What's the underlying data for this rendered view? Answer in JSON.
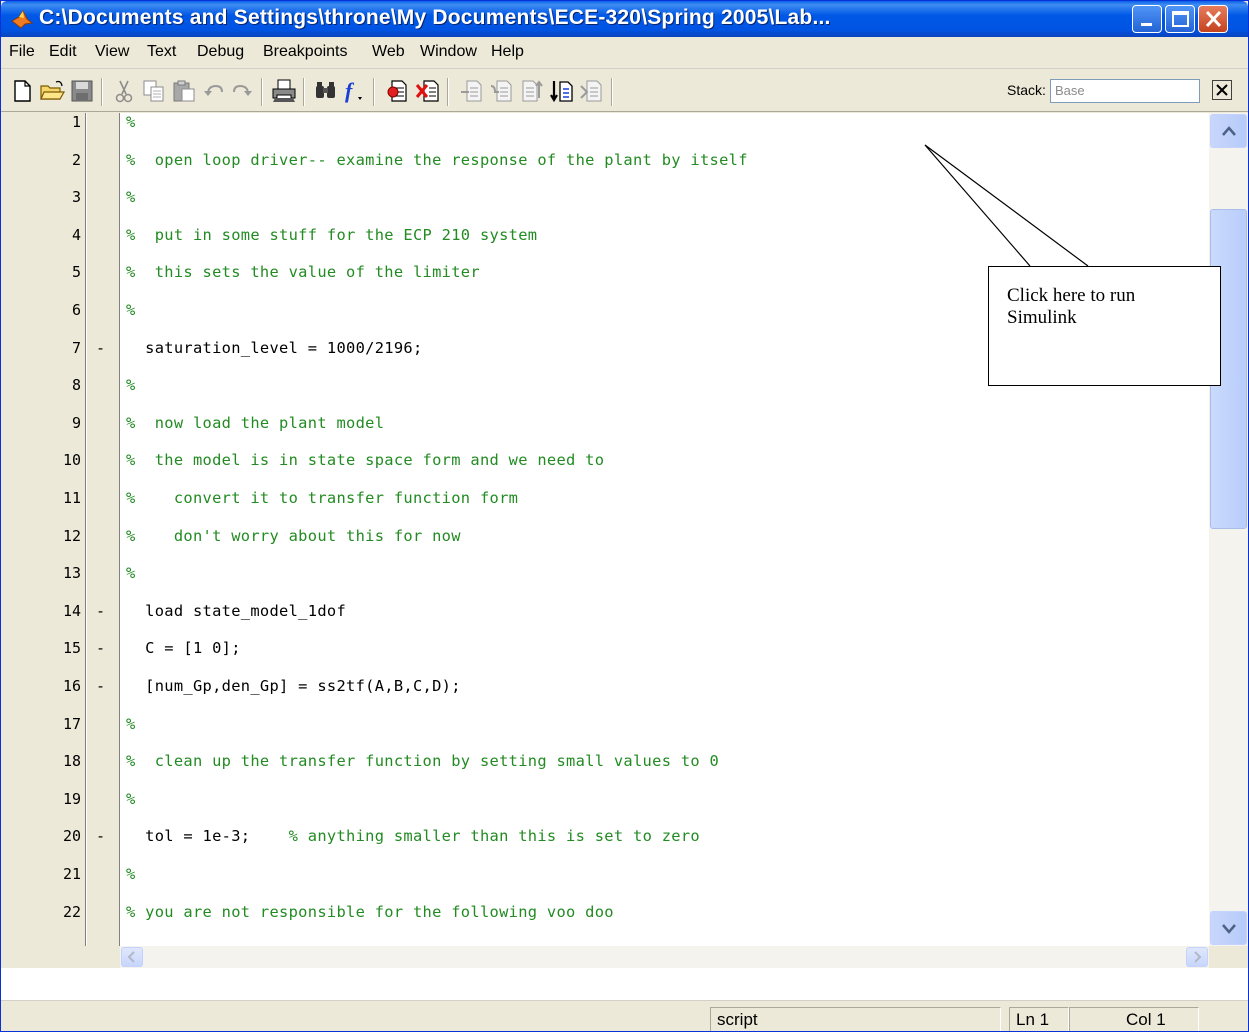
{
  "window": {
    "title": "C:\\Documents and Settings\\throne\\My Documents\\ECE-320\\Spring 2005\\Lab..."
  },
  "menu": [
    "File",
    "Edit",
    "View",
    "Text",
    "Debug",
    "Breakpoints",
    "Web",
    "Window",
    "Help"
  ],
  "toolbar": {
    "stack_label": "Stack:",
    "stack_value": "Base",
    "icons": [
      "new-file-icon",
      "open-folder-icon",
      "save-icon",
      "cut-icon",
      "copy-icon",
      "paste-icon",
      "undo-icon",
      "redo-icon",
      "print-icon",
      "find-icon",
      "function-icon",
      "set-breakpoint-icon",
      "clear-breakpoint-icon",
      "step-icon",
      "step-in-icon",
      "step-out-icon",
      "run-icon",
      "exit-debug-icon",
      "close-editor-icon"
    ]
  },
  "editor": {
    "lines": [
      {
        "n": "1",
        "mark": "",
        "type": "comment",
        "text": "%"
      },
      {
        "n": "2",
        "mark": "",
        "type": "comment",
        "text": "%  open loop driver-- examine the response of the plant by itself"
      },
      {
        "n": "3",
        "mark": "",
        "type": "comment",
        "text": "%"
      },
      {
        "n": "4",
        "mark": "",
        "type": "comment",
        "text": "%  put in some stuff for the ECP 210 system"
      },
      {
        "n": "5",
        "mark": "",
        "type": "comment",
        "text": "%  this sets the value of the limiter"
      },
      {
        "n": "6",
        "mark": "",
        "type": "comment",
        "text": "%"
      },
      {
        "n": "7",
        "mark": "-",
        "type": "code",
        "text": "  saturation_level = 1000/2196;"
      },
      {
        "n": "8",
        "mark": "",
        "type": "comment",
        "text": "%"
      },
      {
        "n": "9",
        "mark": "",
        "type": "comment",
        "text": "%  now load the plant model"
      },
      {
        "n": "10",
        "mark": "",
        "type": "comment",
        "text": "%  the model is in state space form and we need to"
      },
      {
        "n": "11",
        "mark": "",
        "type": "comment",
        "text": "%    convert it to transfer function form"
      },
      {
        "n": "12",
        "mark": "",
        "type": "comment",
        "text": "%    don't worry about this for now"
      },
      {
        "n": "13",
        "mark": "",
        "type": "comment",
        "text": "%"
      },
      {
        "n": "14",
        "mark": "-",
        "type": "code",
        "text": "  load state_model_1dof"
      },
      {
        "n": "15",
        "mark": "-",
        "type": "code",
        "text": "  C = [1 0];"
      },
      {
        "n": "16",
        "mark": "-",
        "type": "code",
        "text": "  [num_Gp,den_Gp] = ss2tf(A,B,C,D);"
      },
      {
        "n": "17",
        "mark": "",
        "type": "comment",
        "text": "%"
      },
      {
        "n": "18",
        "mark": "",
        "type": "comment",
        "text": "%  clean up the transfer function by setting small values to 0"
      },
      {
        "n": "19",
        "mark": "",
        "type": "comment",
        "text": "%"
      },
      {
        "n": "20",
        "mark": "-",
        "type": "code",
        "text": "  tol = 1e-3;",
        "comment": "    % anything smaller than this is set to zero"
      },
      {
        "n": "21",
        "mark": "",
        "type": "comment",
        "text": "%"
      },
      {
        "n": "22",
        "mark": "",
        "type": "comment",
        "text": "% you are not responsible for the following voo doo"
      }
    ]
  },
  "status": {
    "mode": "script",
    "line": "Ln 1",
    "col": "Col 1"
  },
  "callout": {
    "text_line1": "Click here to run",
    "text_line2": "Simulink"
  }
}
